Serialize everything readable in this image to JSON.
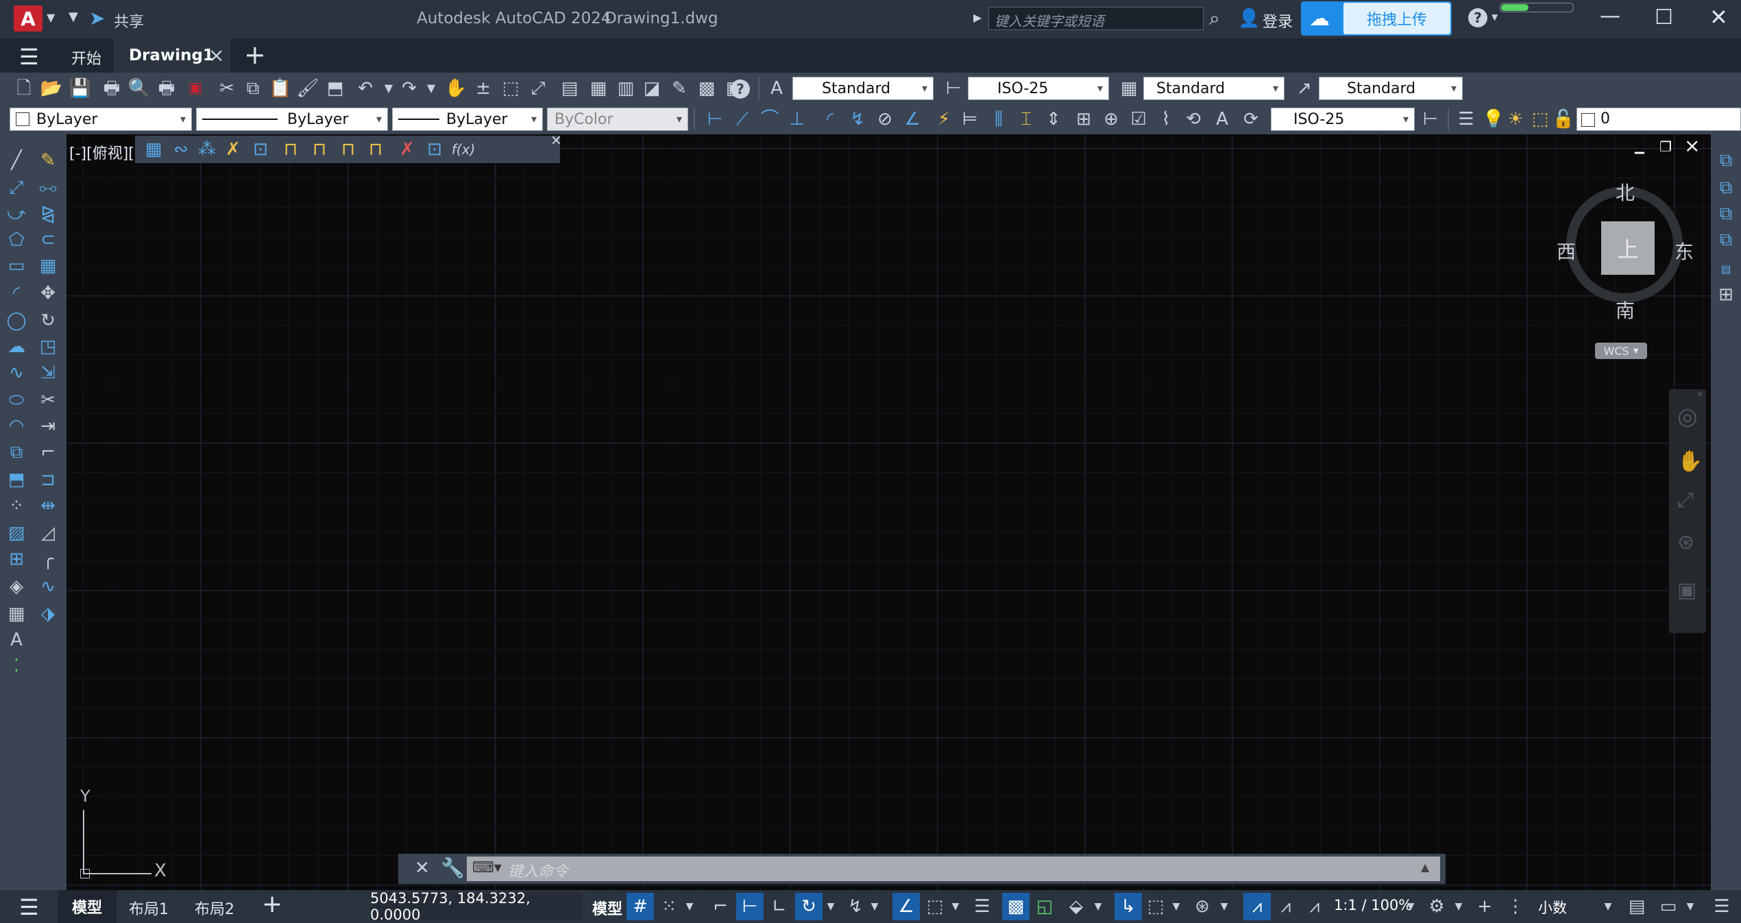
{
  "title_bar": {
    "app_letter": "A",
    "share_label": "共享",
    "window_title": "Autodesk AutoCAD 2024",
    "file_name": "Drawing1.dwg",
    "search_placeholder": "键入关键字或短语",
    "login_label": "登录",
    "upload_label": "拖拽上传",
    "help_label": "?"
  },
  "tabs": {
    "start": "开始",
    "drawing": "Drawing1",
    "close": "×",
    "add": "+"
  },
  "toolbar1": {
    "text_style": "Standard",
    "dim_style": "ISO-25",
    "table_style": "Standard",
    "mleader_style": "Standard",
    "help_glyph": "?"
  },
  "toolbar2": {
    "color": "ByLayer",
    "linetype": "ByLayer",
    "lineweight": "ByLayer",
    "plotstyle": "ByColor",
    "dim_style": "ISO-25",
    "layer": "0"
  },
  "viewport": {
    "label": "[-][俯视][",
    "win_minimize": "▁",
    "win_restore": "❐",
    "win_close": "×",
    "param_close": "×",
    "fx_label": "f(x)"
  },
  "viewcube": {
    "north": "北",
    "south": "南",
    "east": "东",
    "west": "西",
    "top": "上",
    "wcs": "WCS"
  },
  "ucs": {
    "x_label": "X",
    "y_label": "Y"
  },
  "command_line": {
    "placeholder": "键入命令"
  },
  "status_bar": {
    "model_tab": "模型",
    "layout1": "布局1",
    "layout2": "布局2",
    "add": "+",
    "coordinates": "5043.5773, 184.3232, 0.0000",
    "model_button": "模型",
    "scale": "1:1 / 100%",
    "units": "小数"
  },
  "colors": {
    "accent": "#1a5fa8",
    "app_red": "#c9232e",
    "canvas": "#0a0a0b",
    "toolbar": "#3b4453",
    "titlebar": "#2b3340"
  }
}
